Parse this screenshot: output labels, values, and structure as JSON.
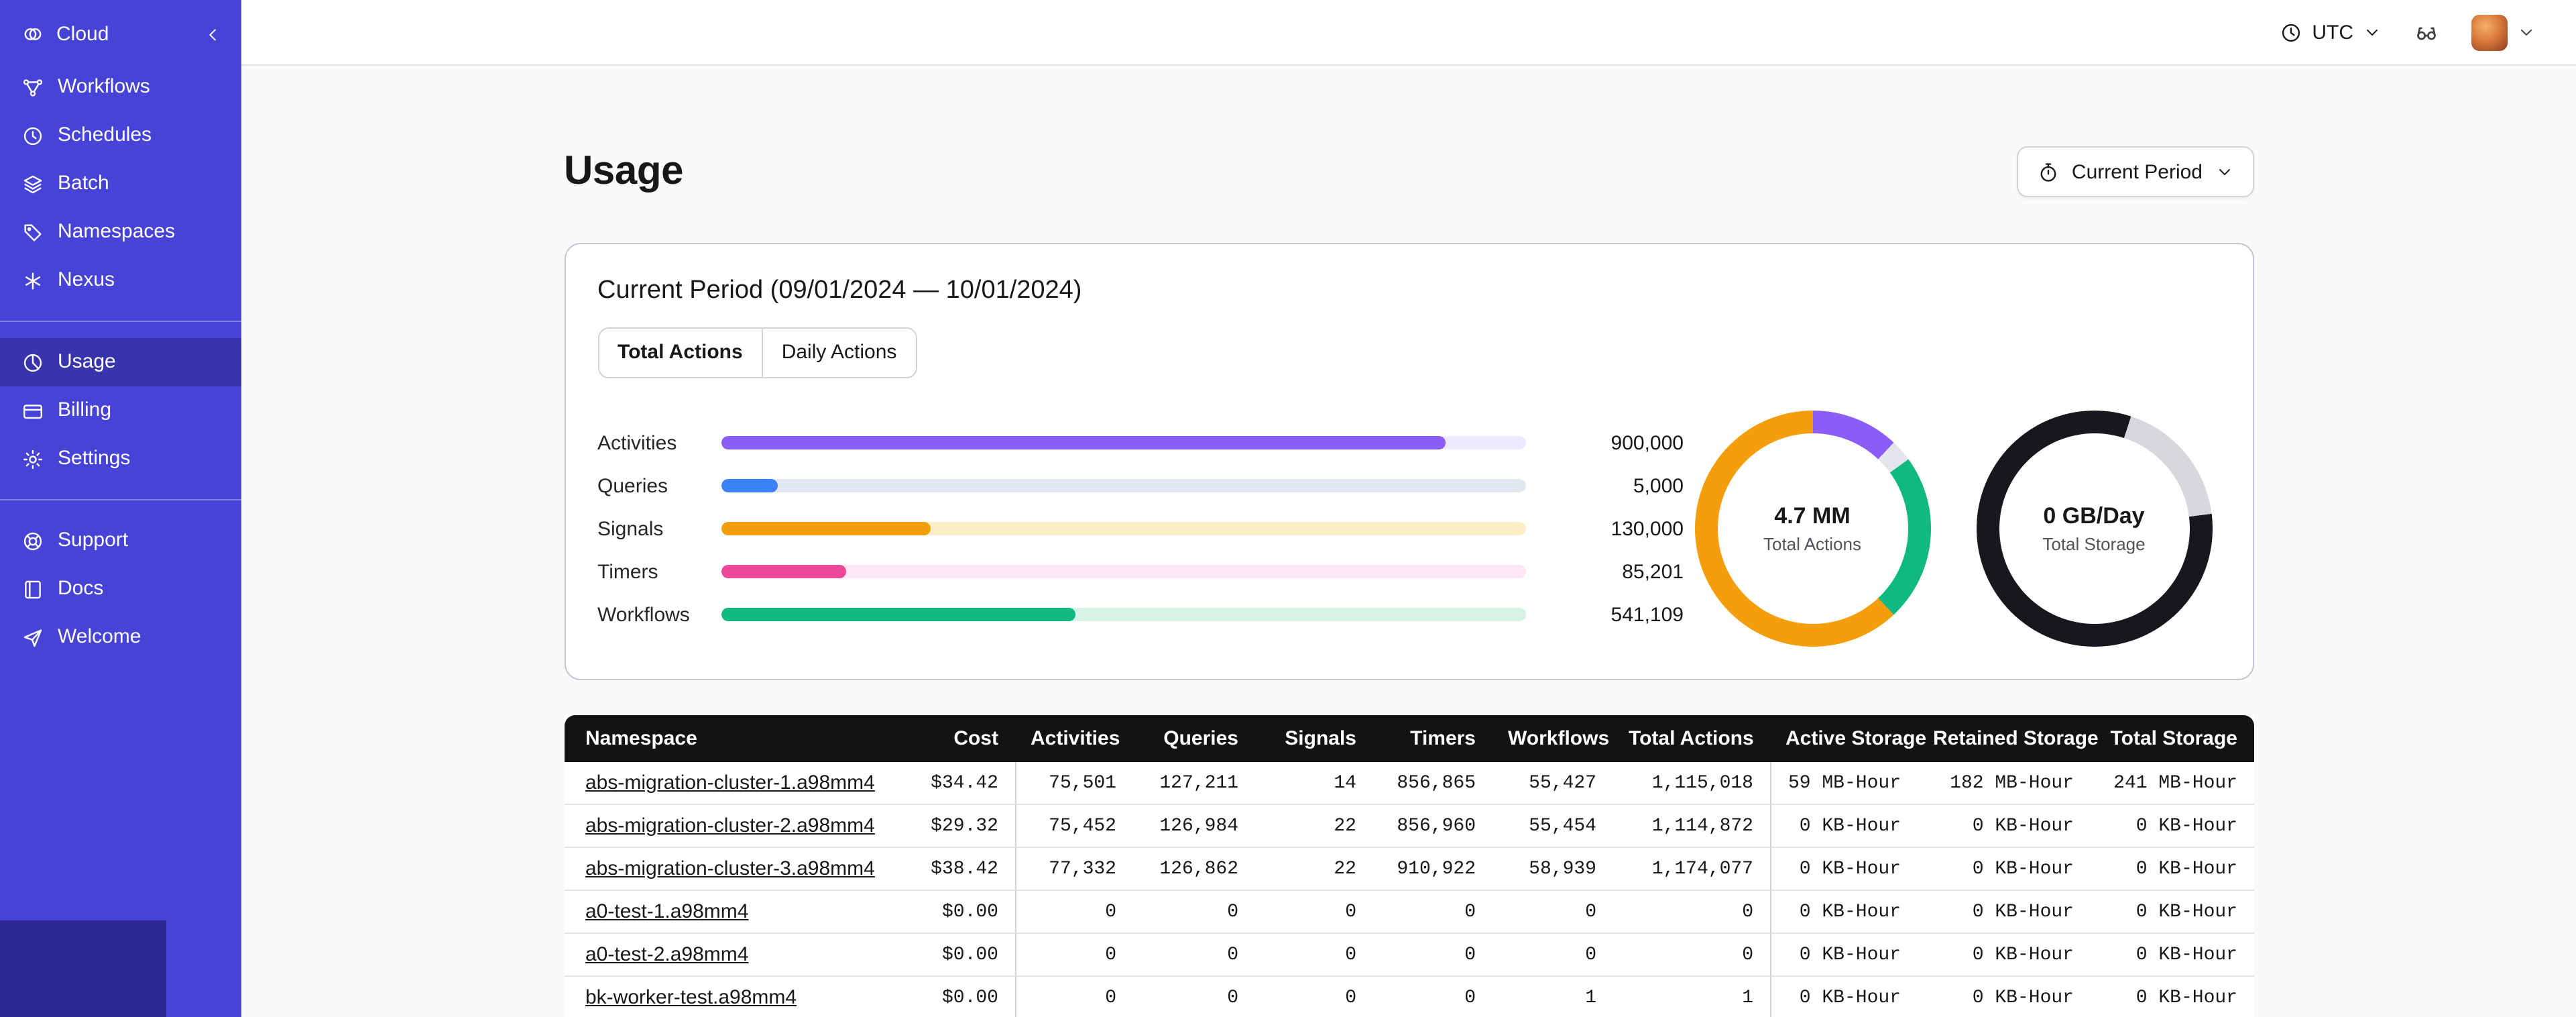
{
  "colors": {
    "sidebar_bg": "#4643d6",
    "sidebar_selected_bg": "#3834ad",
    "table_header_bg": "#131316",
    "page_bg": "#fafafa"
  },
  "sidebar": {
    "logo_label": "Cloud",
    "main_items": [
      {
        "label": "Workflows",
        "icon": "workflows-icon"
      },
      {
        "label": "Schedules",
        "icon": "schedules-icon"
      },
      {
        "label": "Batch",
        "icon": "batch-icon"
      },
      {
        "label": "Namespaces",
        "icon": "namespaces-icon"
      },
      {
        "label": "Nexus",
        "icon": "nexus-icon"
      }
    ],
    "account_items": [
      {
        "label": "Usage",
        "icon": "usage-icon",
        "selected": true
      },
      {
        "label": "Billing",
        "icon": "billing-icon",
        "selected": false
      },
      {
        "label": "Settings",
        "icon": "settings-icon",
        "selected": false
      }
    ],
    "footer_items": [
      {
        "label": "Support",
        "icon": "support-icon",
        "selected": false
      },
      {
        "label": "Docs",
        "icon": "docs-icon",
        "selected": false
      },
      {
        "label": "Welcome",
        "icon": "welcome-icon",
        "selected": false
      }
    ]
  },
  "topbar": {
    "timezone": "UTC"
  },
  "page": {
    "title": "Usage",
    "period_button_label": "Current Period"
  },
  "card": {
    "title": "Current Period (09/01/2024 — 10/01/2024)",
    "tabs": [
      {
        "label": "Total Actions",
        "selected": true
      },
      {
        "label": "Daily Actions",
        "selected": false
      }
    ]
  },
  "chart_data": [
    {
      "type": "bar",
      "orientation": "horizontal",
      "title": "Total Actions breakdown",
      "categories": [
        "Activities",
        "Queries",
        "Signals",
        "Timers",
        "Workflows"
      ],
      "values": [
        900000,
        5000,
        130000,
        85201,
        541109
      ],
      "value_labels": [
        "900,000",
        "5,000",
        "130,000",
        "85,201",
        "541,109"
      ],
      "colors": [
        "#8b5cf6",
        "#3b82f6",
        "#f59e0b",
        "#ec4899",
        "#10b981"
      ],
      "track_colors": [
        "#ede9fe",
        "#e2e8f0",
        "#fdeec7",
        "#fce7f3",
        "#d6f3e6"
      ],
      "fill_pct": [
        90,
        7,
        26,
        15.5,
        44
      ],
      "grid": false,
      "legend": false
    },
    {
      "type": "donut",
      "center_value": "4.7 MM",
      "center_label": "Total Actions",
      "segments": [
        {
          "color": "#8b5cf6",
          "pct": 12
        },
        {
          "color": "#e4e4ec",
          "pct": 3
        },
        {
          "color": "#10b981",
          "pct": 23
        },
        {
          "color": "#f59e0b",
          "pct": 62
        }
      ]
    },
    {
      "type": "donut",
      "center_value": "0 GB/Day",
      "center_label": "Total Storage",
      "segments": [
        {
          "color": "#16181d",
          "pct": 5
        },
        {
          "color": "#d7d7de",
          "pct": 18
        },
        {
          "color": "#16181d",
          "pct": 77
        }
      ]
    }
  ],
  "table": {
    "columns": [
      "Namespace",
      "Cost",
      "Activities",
      "Queries",
      "Signals",
      "Timers",
      "Workflows",
      "Total Actions",
      "Active Storage",
      "Retained Storage",
      "Total Storage"
    ],
    "rows": [
      [
        "abs-migration-cluster-1.a98mm4",
        "$34.42",
        "75,501",
        "127,211",
        "14",
        "856,865",
        "55,427",
        "1,115,018",
        "59 MB-Hour",
        "182 MB-Hour",
        "241 MB-Hour"
      ],
      [
        "abs-migration-cluster-2.a98mm4",
        "$29.32",
        "75,452",
        "126,984",
        "22",
        "856,960",
        "55,454",
        "1,114,872",
        "0 KB-Hour",
        "0 KB-Hour",
        "0 KB-Hour"
      ],
      [
        "abs-migration-cluster-3.a98mm4",
        "$38.42",
        "77,332",
        "126,862",
        "22",
        "910,922",
        "58,939",
        "1,174,077",
        "0 KB-Hour",
        "0 KB-Hour",
        "0 KB-Hour"
      ],
      [
        "a0-test-1.a98mm4",
        "$0.00",
        "0",
        "0",
        "0",
        "0",
        "0",
        "0",
        "0 KB-Hour",
        "0 KB-Hour",
        "0 KB-Hour"
      ],
      [
        "a0-test-2.a98mm4",
        "$0.00",
        "0",
        "0",
        "0",
        "0",
        "0",
        "0",
        "0 KB-Hour",
        "0 KB-Hour",
        "0 KB-Hour"
      ],
      [
        "bk-worker-test.a98mm4",
        "$0.00",
        "0",
        "0",
        "0",
        "0",
        "1",
        "1",
        "0 KB-Hour",
        "0 KB-Hour",
        "0 KB-Hour"
      ]
    ]
  }
}
